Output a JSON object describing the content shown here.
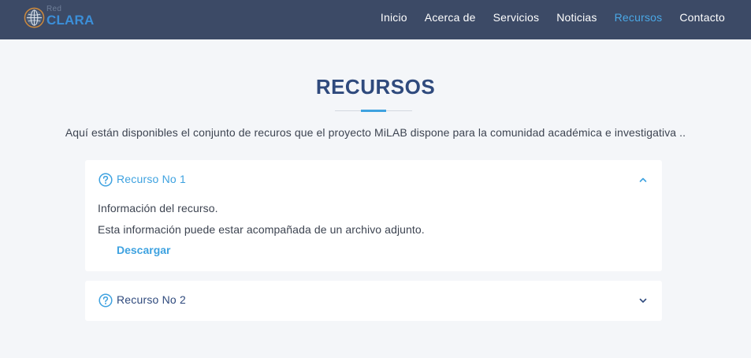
{
  "header": {
    "logo": {
      "small": "Red",
      "main": "CLARA"
    },
    "nav": [
      {
        "label": "Inicio",
        "active": false
      },
      {
        "label": "Acerca de",
        "active": false
      },
      {
        "label": "Servicios",
        "active": false
      },
      {
        "label": "Noticias",
        "active": false
      },
      {
        "label": "Recursos",
        "active": true
      },
      {
        "label": "Contacto",
        "active": false
      }
    ]
  },
  "page": {
    "title": "RECURSOS",
    "intro": "Aquí están disponibles el conjunto de recuros que el proyecto MiLAB dispone para la comunidad académica e investigativa .."
  },
  "accordion": [
    {
      "title": "Recurso No 1",
      "expanded": true,
      "icon": "question-circle-icon",
      "body": [
        "Información del recurso.",
        "Esta información puede estar acompañada de un archivo adjunto."
      ],
      "link": "Descargar"
    },
    {
      "title": "Recurso No 2",
      "expanded": false,
      "icon": "question-circle-icon"
    }
  ],
  "colors": {
    "header_bg": "#3c4a66",
    "accent": "#3ea2e0",
    "title": "#2f4a7d",
    "page_bg": "#f4f6f9"
  }
}
